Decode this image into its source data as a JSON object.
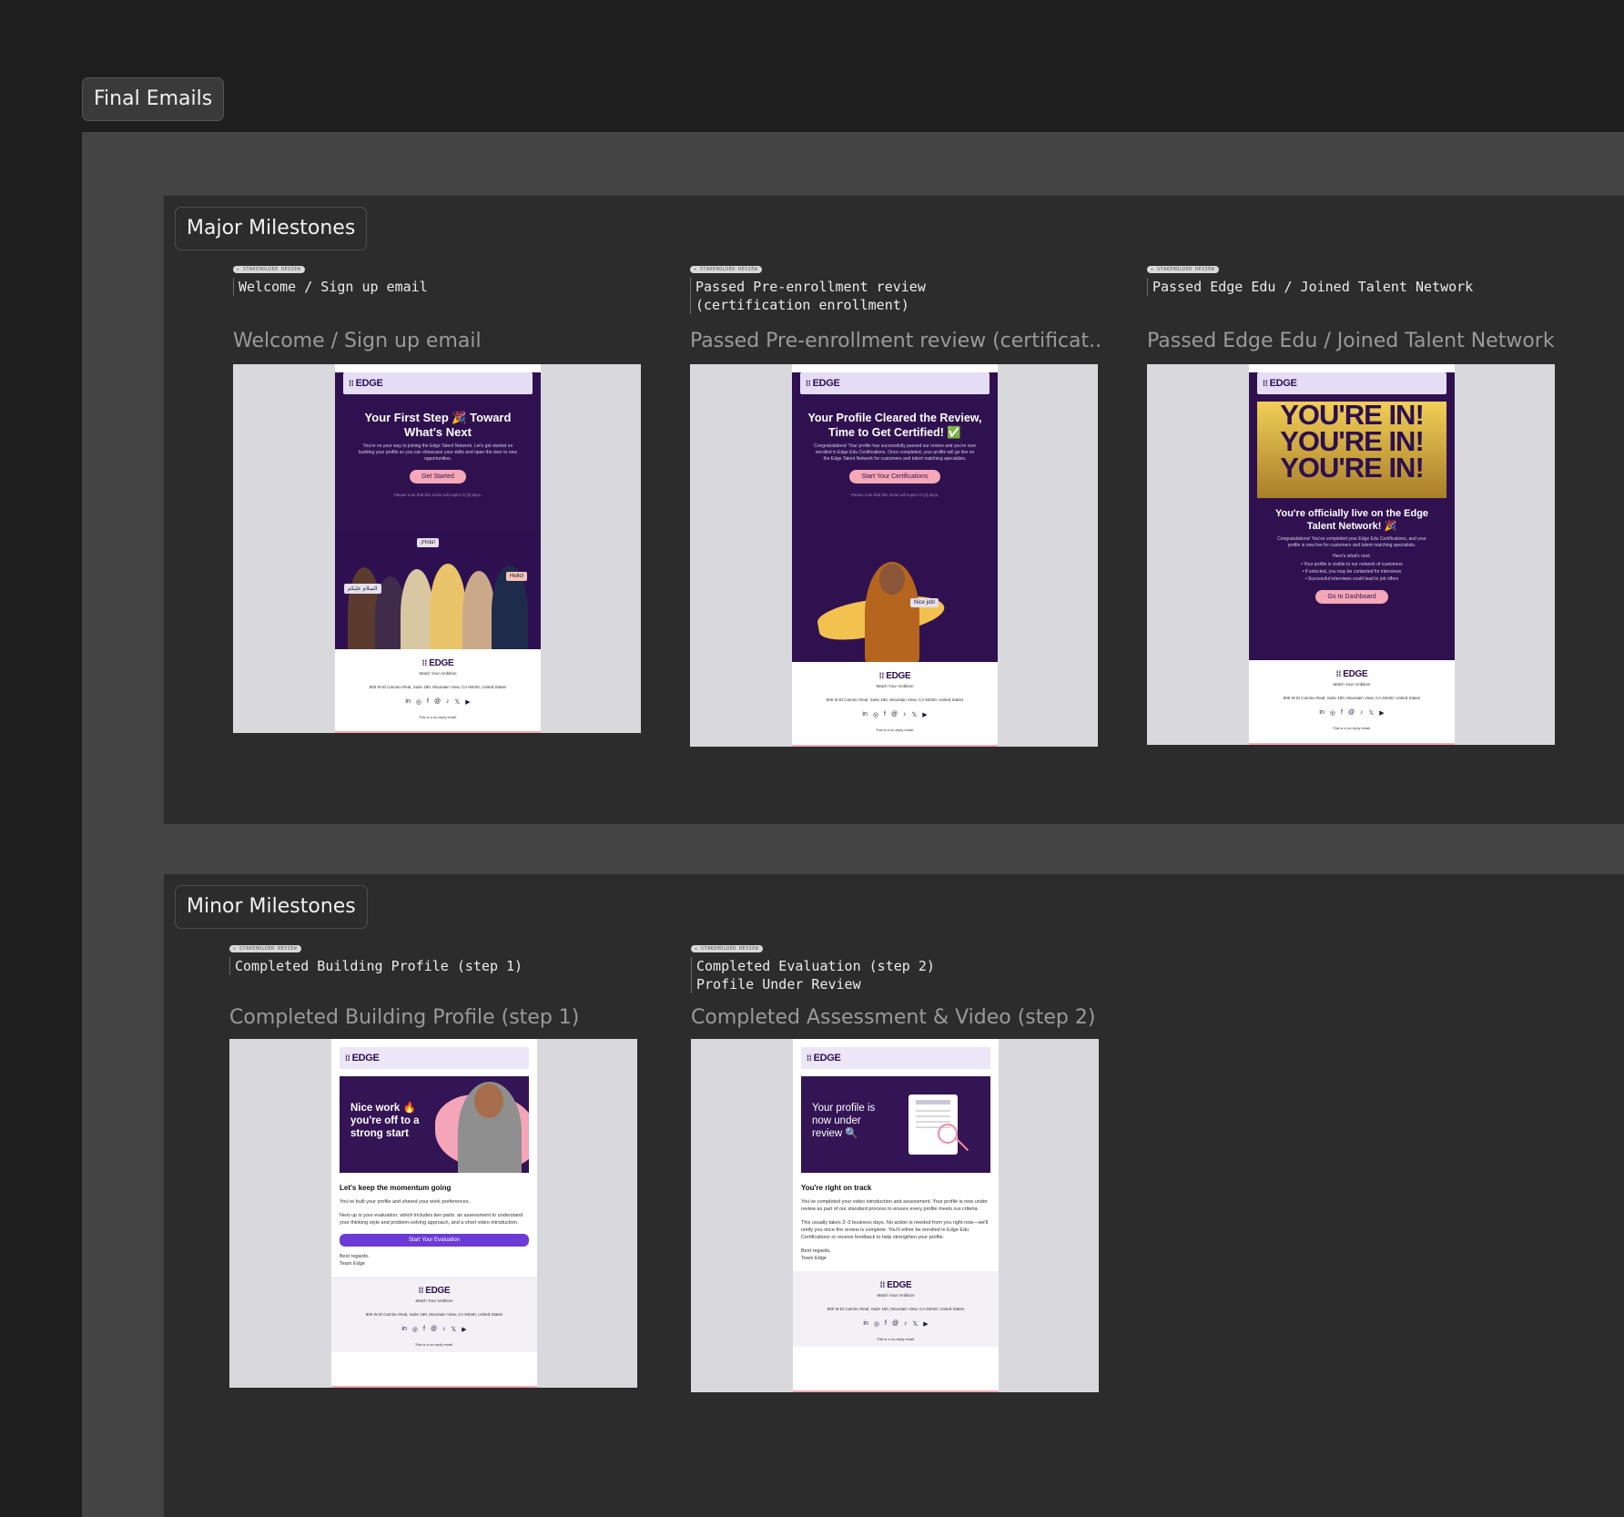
{
  "outer_label": "Final Emails",
  "major": {
    "label": "Major Milestones",
    "items": [
      {
        "tag": "STAKEHOLDER REVIEW",
        "note": "Welcome / Sign up email",
        "title": "Welcome / Sign up email",
        "email": {
          "logo": "EDGE",
          "heading": "Your First Step 🎉 Toward What's Next",
          "body": "You're on your way to joining the Edge Talent Network. Let's get started on building your profile so you can showcase your skills and open the door to new opportunities.",
          "cta": "Get Started",
          "note": "Please note that this invite will expire in [3] days.",
          "bubbles": [
            "¡Hola!",
            "Hello!",
            "السلام عليكم"
          ]
        }
      },
      {
        "tag": "STAKEHOLDER REVIEW",
        "note": "Passed Pre-enrollment review\n(certification enrollment)",
        "title": "Passed Pre-enrollment review (certificat...",
        "email": {
          "logo": "EDGE",
          "heading": "Your Profile Cleared the Review, Time to Get Certified! ✅",
          "body": "Congratulations! Your profile has successfully passed our review and you're now enrolled in Edge Edu Certifications. Once completed, your profile will go live on the Edge Talent Network for customers and talent matching specialists.",
          "cta": "Start Your Certifications",
          "note": "Please note that this invite will expire in [3] days.",
          "bubbles": [
            "Nice job!"
          ]
        }
      },
      {
        "tag": "STAKEHOLDER REVIEW",
        "note": "Passed Edge Edu / Joined Talent Network",
        "title": "Passed Edge Edu / Joined Talent Network",
        "email": {
          "logo": "EDGE",
          "banner": "YOU'RE IN!",
          "heading": "You're officially live on the Edge Talent Network! 🎉",
          "body": "Congratulations! You've completed your Edge Edu Certifications, and your profile is now live for customers and talent matching specialists.",
          "list_title": "Here's what's next:",
          "list": [
            "Your profile is visible to our network of customers",
            "If selected, you may be contacted for interviews",
            "Successful interviews could lead to job offers"
          ],
          "cta": "Go to Dashboard"
        }
      }
    ]
  },
  "minor": {
    "label": "Minor Milestones",
    "items": [
      {
        "tag": "STAKEHOLDER REVIEW",
        "note": "Completed Building Profile (step 1)",
        "title": "Completed Building Profile (step 1)",
        "email": {
          "logo": "EDGE",
          "hero": "Nice work 🔥 you're off to a strong start",
          "heading": "Let's keep the momentum going",
          "p1": "You've built your profile and shared your work preferences.",
          "p2": "Next up is your evaluation, which includes two parts: an assessment to understand your thinking style and problem-solving approach, and a short video introduction.",
          "cta": "Start Your Evaluation",
          "sign": "Best regards,\nTeam Edge"
        }
      },
      {
        "tag": "STAKEHOLDER REVIEW",
        "note": "Completed Evaluation (step 2)\nProfile Under Review",
        "title": "Completed Assessment & Video (step 2)",
        "email": {
          "logo": "EDGE",
          "hero": "Your profile is now under review 🔍",
          "heading": "You're right on track",
          "p1": "You've completed your video introduction and assessment. Your profile is now under review as part of our standard process to ensure every profile meets our criteria.",
          "p2": "This usually takes 2–3 business days. No action is needed from you right now—we'll notify you once the review is complete. You'll either be enrolled in Edge Edu Certifications or receive feedback to help strengthen your profile.",
          "sign": "Best regards,\nTeam Edge"
        }
      }
    ]
  },
  "footer": {
    "logo": "EDGE",
    "tagline": "Match Your Ambition",
    "address": "800 W El Camino Real, Suite 180, Mountain View, CA 94040, United States",
    "social": [
      "in",
      "◎",
      "f",
      "@",
      "♪",
      "𝕏",
      "▶"
    ],
    "noreply": "This is a no-reply email."
  },
  "colors": {
    "brand_purple": "#301150",
    "cta_pink": "#f5a8b7",
    "header_lilac": "#e5dcf5",
    "button_violet": "#6c3bd6"
  }
}
